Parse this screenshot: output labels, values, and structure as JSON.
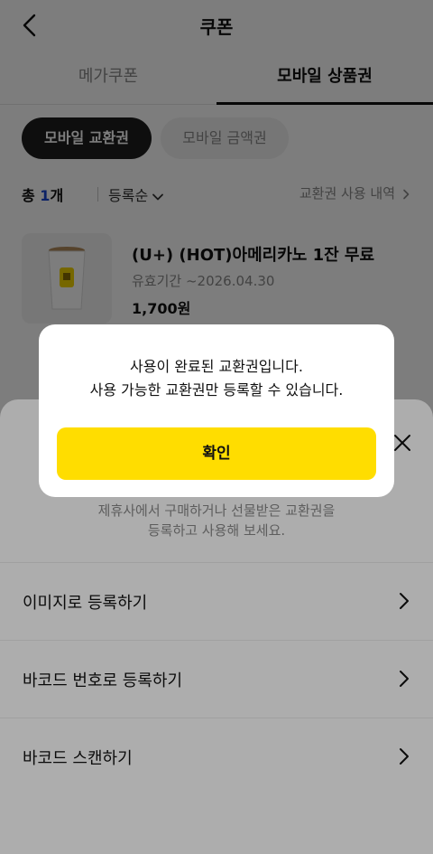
{
  "header": {
    "title": "쿠폰"
  },
  "tabs": [
    {
      "label": "메가쿠폰"
    },
    {
      "label": "모바일 상품권"
    }
  ],
  "chips": [
    {
      "label": "모바일 교환권"
    },
    {
      "label": "모바일 금액권"
    }
  ],
  "filter": {
    "total_prefix": "총 ",
    "count": "1",
    "total_suffix": "개",
    "sort_label": "등록순",
    "history_label": "교환권 사용 내역"
  },
  "coupon": {
    "name": "(U+) (HOT)아메리카노 1잔 무료",
    "expiry": "유효기간 ~2026.04.30",
    "price": "1,700원"
  },
  "sheet": {
    "description": [
      "제휴사에서 구매하거나 선물받은 교환권을",
      "등록하고 사용해 보세요."
    ],
    "options": [
      {
        "label": "이미지로 등록하기"
      },
      {
        "label": "바코드 번호로 등록하기"
      },
      {
        "label": "바코드 스캔하기"
      }
    ]
  },
  "dialog": {
    "message": [
      "사용이 완료된 교환권입니다.",
      "사용 가능한 교환권만 등록할 수 있습니다."
    ],
    "confirm_label": "확인"
  },
  "colors": {
    "accent_yellow": "#ffdd00",
    "count_blue": "#1a47d1",
    "chip_active": "#1f1f1f"
  }
}
